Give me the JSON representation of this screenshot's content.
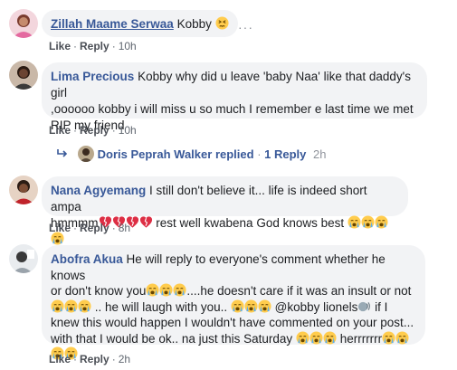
{
  "comments": [
    {
      "author": "Zillah Maame Serwaa",
      "text": "Kobby",
      "like": "Like",
      "reply": "Reply",
      "time": "10h"
    },
    {
      "author": "Lima Precious",
      "text_line1": "Kobby why did u leave 'baby Naa' like that daddy's girl",
      "text_line2": ",oooooo kobby i will miss u so much I remember e last time we met",
      "text_line3": "RIP my friend",
      "like": "Like",
      "reply": "Reply",
      "time": "10h",
      "reply_summary": {
        "replier": "Doris Peprah Walker",
        "replied_label": "replied",
        "reply_count": "1 Reply",
        "time": "2h"
      }
    },
    {
      "author": "Nana Agyemang",
      "text_line1": "I still don't believe it... life is indeed short ampa",
      "text_line2_a": "hmmmm",
      "text_line2_b": "rest well kwabena God knows best",
      "like": "Like",
      "reply": "Reply",
      "time": "8h"
    },
    {
      "author": "Abofra Akua",
      "text_line1": "He will reply to everyone's comment whether he knows",
      "text_line2_a": "or don't know you",
      "text_line2_b": "....he doesn't care if it was an insult or not",
      "text_line3_a": ".. he will laugh with you..",
      "text_line3_b": "@kobby lionels",
      "text_line3_c": "if I",
      "text_line4": "knew this would happen I wouldn't have commented on your post...",
      "text_line5_a": "with that I would be ok.. na just this Saturday",
      "text_line5_b": "herrrrrrr",
      "like": "Like",
      "reply": "Reply",
      "time": "2h"
    }
  ],
  "more_options": "···",
  "separator": "·",
  "colors": {
    "link": "#385898",
    "bubble": "#f2f3f5",
    "meta": "#606770"
  },
  "icons": [
    "crying-face-icon",
    "persevering-face-icon",
    "broken-heart-icon",
    "reply-arrow-icon",
    "speaking-head-icon"
  ]
}
